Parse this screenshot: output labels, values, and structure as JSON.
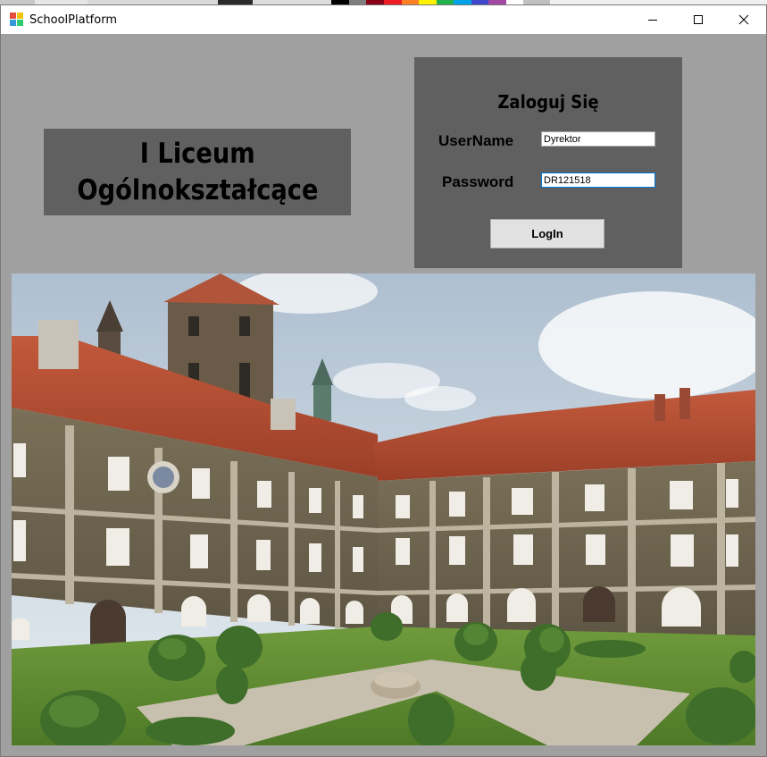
{
  "window": {
    "title": "SchoolPlatform"
  },
  "school": {
    "line1": "I Liceum",
    "line2": "Ogólnokształcące"
  },
  "login": {
    "heading": "Zaloguj Się",
    "username_label": "UserName",
    "username_value": "Dyrektor",
    "password_label": "Password",
    "password_value": "DR121518",
    "button_label": "LogIn"
  },
  "colors": {
    "form_background": "#a0a0a0",
    "panel_background": "#606060",
    "focus_border": "#0078d7"
  },
  "photo": {
    "icon": "school-building-photo"
  }
}
